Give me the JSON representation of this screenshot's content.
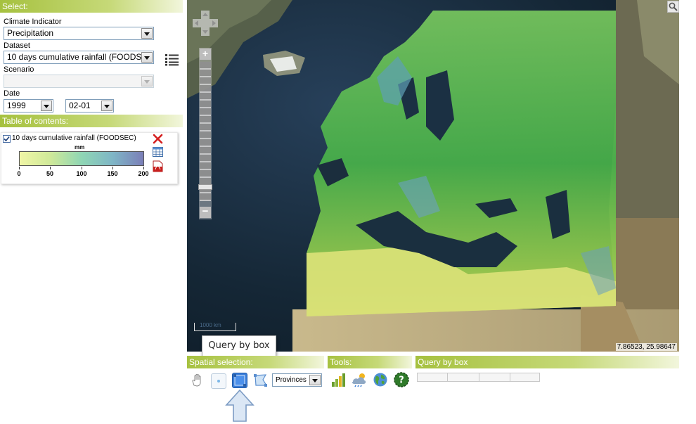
{
  "select_panel": {
    "header": "Select:",
    "climate_indicator_label": "Climate Indicator",
    "climate_indicator_value": "Precipitation",
    "dataset_label": "Dataset",
    "dataset_value": "10 days cumulative rainfall (FOODSEC)",
    "scenario_label": "Scenario",
    "scenario_value": "",
    "date_label": "Date",
    "year_value": "1999",
    "day_value": "02-01"
  },
  "toc": {
    "header": "Table of contents:",
    "layer_name": "10 days cumulative rainfall (FOODSEC)",
    "layer_checked": true,
    "legend_unit": "mm",
    "legend_ticks": [
      "0",
      "50",
      "100",
      "150",
      "200"
    ],
    "legend_colors": [
      "#f0f6a6",
      "#cfe999",
      "#8fd6b4",
      "#7fb6c6",
      "#7b7fb8"
    ]
  },
  "map": {
    "scale_label": "1000 km",
    "coordinates": "7.86523, 25.98647"
  },
  "tooltip": {
    "text": "Query by box"
  },
  "bottom": {
    "spatial_header": "Spatial selection:",
    "tools_header": "Tools:",
    "query_header": "Query by box",
    "region_select_value": "Provinces"
  },
  "icons": {
    "list": "list-icon",
    "search": "search-icon",
    "pan": "pan-hand-icon",
    "zoom_in": "zoom-in-icon",
    "zoom_out": "zoom-out-icon",
    "remove": "remove-x-icon",
    "table": "table-icon",
    "pdf": "pdf-icon",
    "point": "point-select-icon",
    "box": "box-select-icon",
    "polygon": "polygon-select-icon",
    "chart": "bar-chart-icon",
    "weather": "weather-icon",
    "globe": "globe-icon",
    "help": "help-icon",
    "arrow": "up-arrow-icon"
  }
}
